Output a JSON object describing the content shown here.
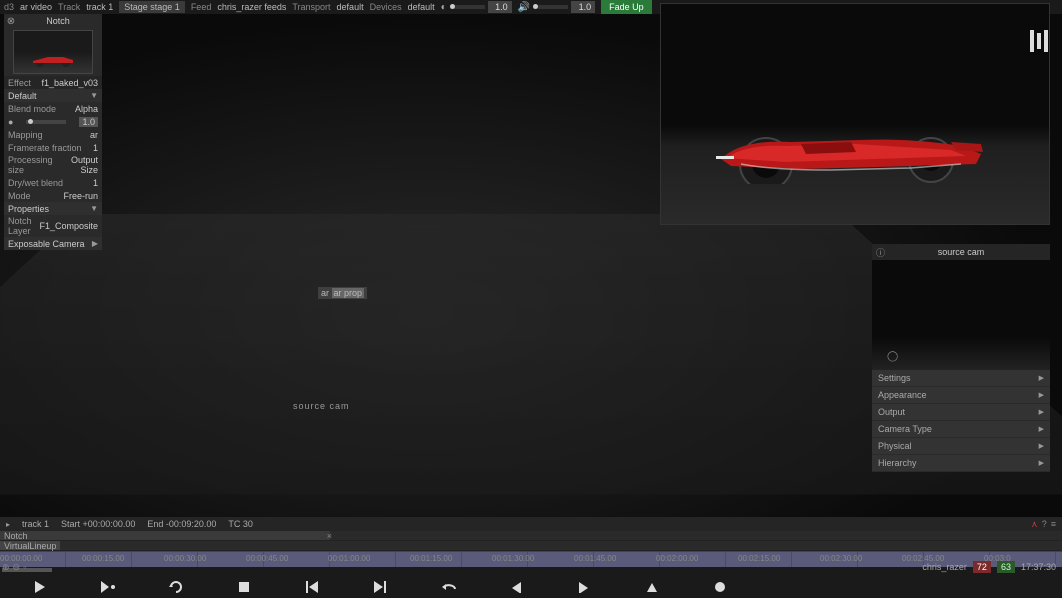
{
  "topbar": {
    "app": "d3",
    "project": "ar video",
    "track_label": "Track",
    "track_value": "track 1",
    "stage_label": "Stage",
    "stage_value": "stage 1",
    "feed_label": "Feed",
    "feed_value": "chris_razer feeds",
    "transport_label": "Transport",
    "transport_value": "default",
    "devices_label": "Devices",
    "devices_value": "default",
    "brightness_value": "1.0",
    "volume_value": "1.0",
    "fadeup": "Fade Up"
  },
  "inspector": {
    "title": "Notch",
    "effect_label": "Effect",
    "effect_value": "f1_baked_v03",
    "preset": "Default",
    "blend_mode_label": "Blend mode",
    "blend_mode_value": "Alpha",
    "opacity_value": "1.0",
    "mapping_label": "Mapping",
    "mapping_value": "ar",
    "framerate_label": "Framerate fraction",
    "framerate_value": "1",
    "processing_label": "Processing size",
    "processing_value": "Output Size",
    "drywet_label": "Dry/wet blend",
    "drywet_value": "1",
    "mode_label": "Mode",
    "mode_value": "Free-run",
    "properties_label": "Properties",
    "notch_layer_label": "Notch Layer",
    "notch_layer_value": "F1_Composite",
    "exposable_label": "Exposable Camera"
  },
  "viewport": {
    "ar_prop_label": "ar prop",
    "source_cam_label": "source cam"
  },
  "right_panel": {
    "title": "source cam",
    "rows": [
      {
        "label": "Settings"
      },
      {
        "label": "Appearance"
      },
      {
        "label": "Output"
      },
      {
        "label": "Camera Type"
      },
      {
        "label": "Physical"
      },
      {
        "label": "Hierarchy"
      }
    ]
  },
  "timeline": {
    "track_name": "track 1",
    "start_label": "Start +00:00:00.00",
    "end_label": "End -00:09:20.00",
    "tc_label": "TC 30",
    "track_notch": "Notch",
    "track_virtual": "VirtualLineup",
    "ticks": [
      "00:00:00.00",
      "00:00:15.00",
      "00:00:30.00",
      "00:00:45.00",
      "00:01:00.00",
      "00:01:15.00",
      "00:01:30.00",
      "00:01:45.00",
      "00:02:00.00",
      "00:02:15.00",
      "00:02:30.00",
      "00:02:45.00",
      "00:03:0"
    ]
  },
  "status": {
    "user": "chris_razer",
    "fps1": "72",
    "fps2": "63",
    "time": "17:37:30",
    "help": "?"
  }
}
